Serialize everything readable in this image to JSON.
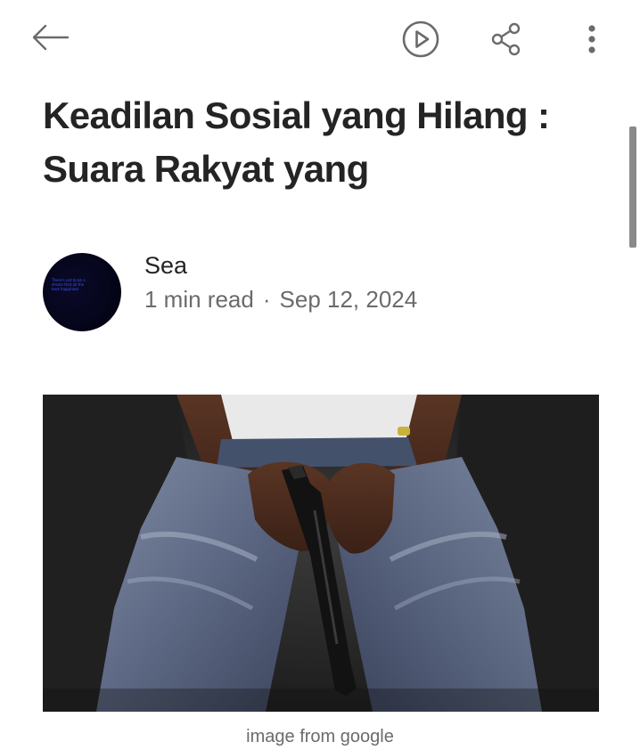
{
  "header": {
    "back_icon": "arrow-left-icon",
    "play_icon": "play-circle-icon",
    "share_icon": "share-icon",
    "more_icon": "more-vertical-icon"
  },
  "article": {
    "title": "Keadilan Sosial yang Hilang : Suara Rakyat yang",
    "author": {
      "name": "Sea",
      "avatar_text": "There's not to be a dream that all the best happiness"
    },
    "meta": {
      "read_time": "1 min read",
      "separator": "·",
      "date": "Sep 12, 2024"
    },
    "image": {
      "subject": "person seated holding a handgun between jeans-clad knees"
    },
    "caption": "image from google"
  },
  "colors": {
    "text_primary": "#242424",
    "text_secondary": "#6b6b6b",
    "icon": "#6b6b6b",
    "avatar_text": "#3b52ff"
  }
}
